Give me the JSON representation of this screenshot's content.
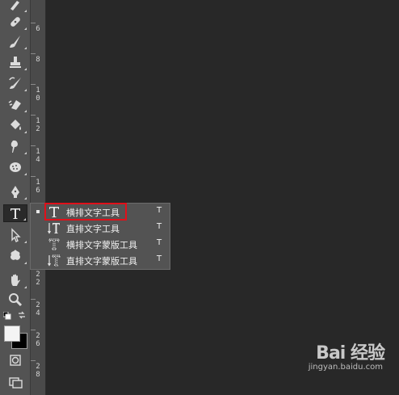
{
  "toolbar": {
    "tools": [
      {
        "name": "brush-tool-top",
        "icon": "brush-icon"
      },
      {
        "name": "spot-healing-tool",
        "icon": "bandage-icon"
      },
      {
        "name": "brush-tool",
        "icon": "brush-icon"
      },
      {
        "name": "clone-stamp-tool",
        "icon": "stamp-icon"
      },
      {
        "name": "history-brush-tool",
        "icon": "history-brush-icon"
      },
      {
        "name": "eraser-tool",
        "icon": "eraser-icon"
      },
      {
        "name": "paint-bucket-tool",
        "icon": "paint-bucket-icon"
      },
      {
        "name": "smudge-tool",
        "icon": "smudge-icon"
      },
      {
        "name": "sponge-tool",
        "icon": "sponge-icon"
      },
      {
        "name": "pen-tool",
        "icon": "pen-icon"
      },
      {
        "name": "type-tool",
        "icon": "type-icon"
      },
      {
        "name": "path-selection-tool",
        "icon": "arrow-icon"
      },
      {
        "name": "custom-shape-tool",
        "icon": "shape-icon"
      },
      {
        "name": "hand-tool",
        "icon": "hand-icon"
      },
      {
        "name": "zoom-tool",
        "icon": "zoom-icon"
      }
    ]
  },
  "ruler": {
    "labels": [
      {
        "text": "6"
      },
      {
        "text": "8"
      },
      {
        "text": "1"
      },
      {
        "text": "0"
      },
      {
        "text": "1"
      },
      {
        "text": "2"
      },
      {
        "text": "1"
      },
      {
        "text": "4"
      },
      {
        "text": "1"
      },
      {
        "text": "6"
      },
      {
        "text": "2"
      },
      {
        "text": "2"
      },
      {
        "text": "2"
      },
      {
        "text": "4"
      },
      {
        "text": "2"
      },
      {
        "text": "6"
      },
      {
        "text": "2"
      },
      {
        "text": "8"
      }
    ]
  },
  "flyout": {
    "items": [
      {
        "label": "横排文字工具",
        "key": "T",
        "icon": "horizontal-type-icon",
        "active": true
      },
      {
        "label": "直排文字工具",
        "key": "T",
        "icon": "vertical-type-icon",
        "active": false
      },
      {
        "label": "横排文字蒙版工具",
        "key": "T",
        "icon": "horizontal-type-mask-icon",
        "active": false
      },
      {
        "label": "直排文字蒙版工具",
        "key": "T",
        "icon": "vertical-type-mask-icon",
        "active": false
      }
    ]
  },
  "colors": {
    "foreground": "#f4f4f4",
    "background": "#000000",
    "highlight": "#e0101a"
  },
  "watermark": {
    "brand": "Bai 经验",
    "url": "jingyan.baidu.com"
  }
}
